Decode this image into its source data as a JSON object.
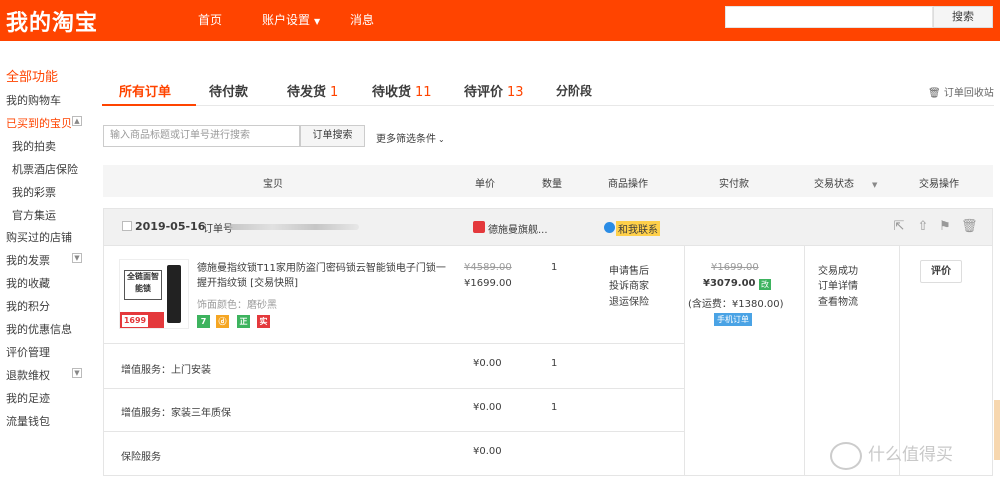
{
  "header": {
    "logo": "我的淘宝",
    "nav": [
      "首页",
      "账户设置",
      "消息"
    ],
    "search_button": "搜索"
  },
  "sidebar": {
    "title": "全部功能",
    "items": [
      {
        "label": "我的购物车"
      },
      {
        "label": "已买到的宝贝",
        "toggle": "▲"
      },
      {
        "label": "我的拍卖"
      },
      {
        "label": "机票酒店保险"
      },
      {
        "label": "我的彩票"
      },
      {
        "label": "官方集运"
      },
      {
        "label": "购买过的店铺"
      },
      {
        "label": "我的发票",
        "toggle": "▼"
      },
      {
        "label": "我的收藏"
      },
      {
        "label": "我的积分"
      },
      {
        "label": "我的优惠信息"
      },
      {
        "label": "评价管理"
      },
      {
        "label": "退款维权",
        "toggle": "▼"
      },
      {
        "label": "我的足迹"
      },
      {
        "label": "流量钱包"
      }
    ]
  },
  "tabs": [
    {
      "label": "所有订单",
      "count": ""
    },
    {
      "label": "待付款",
      "count": ""
    },
    {
      "label": "待发货",
      "count": "1"
    },
    {
      "label": "待收货",
      "count": "11"
    },
    {
      "label": "待评价",
      "count": "13"
    },
    {
      "label": "分阶段",
      "count": ""
    }
  ],
  "recycle": "订单回收站",
  "filter": {
    "placeholder": "输入商品标题或订单号进行搜索",
    "search_button": "订单搜索",
    "more": "更多筛选条件"
  },
  "table_header": [
    "宝贝",
    "单价",
    "数量",
    "商品操作",
    "实付款",
    "交易状态",
    "交易操作"
  ],
  "order": {
    "date": "2019-05-16",
    "order_no_label": "订单号",
    "shop": "德施曼旗舰...",
    "chat": "和我联系",
    "item": {
      "title": "德施曼指纹锁T11家用防盗门密码锁云智能锁电子门锁一握开指纹锁 [交易快照]",
      "color": "饰面颜色：磨砂黑",
      "thumb_text": "全链面智能锁",
      "thumb_price": "1699",
      "badges": [
        "7",
        "ⓓ",
        "正",
        "实"
      ],
      "original_price": "¥4589.00",
      "price": "¥1699.00",
      "quantity": "1",
      "actions": [
        "申请售后",
        "投诉商家",
        "退运保险"
      ]
    },
    "services": [
      {
        "name": "增值服务：上门安装",
        "price": "¥0.00",
        "quantity": "1"
      },
      {
        "name": "增值服务：家装三年质保",
        "price": "¥0.00",
        "quantity": "1"
      },
      {
        "name": "保险服务",
        "price": "¥0.00",
        "quantity": ""
      }
    ],
    "payment": {
      "original": "¥1699.00",
      "total": "¥3079.00",
      "tag": "改",
      "shipping": "(含运费：¥1380.00)",
      "phone_order": "手机订单"
    },
    "status": [
      "交易成功",
      "订单详情",
      "查看物流"
    ],
    "operation": "评价"
  },
  "watermark": "什么值得买"
}
